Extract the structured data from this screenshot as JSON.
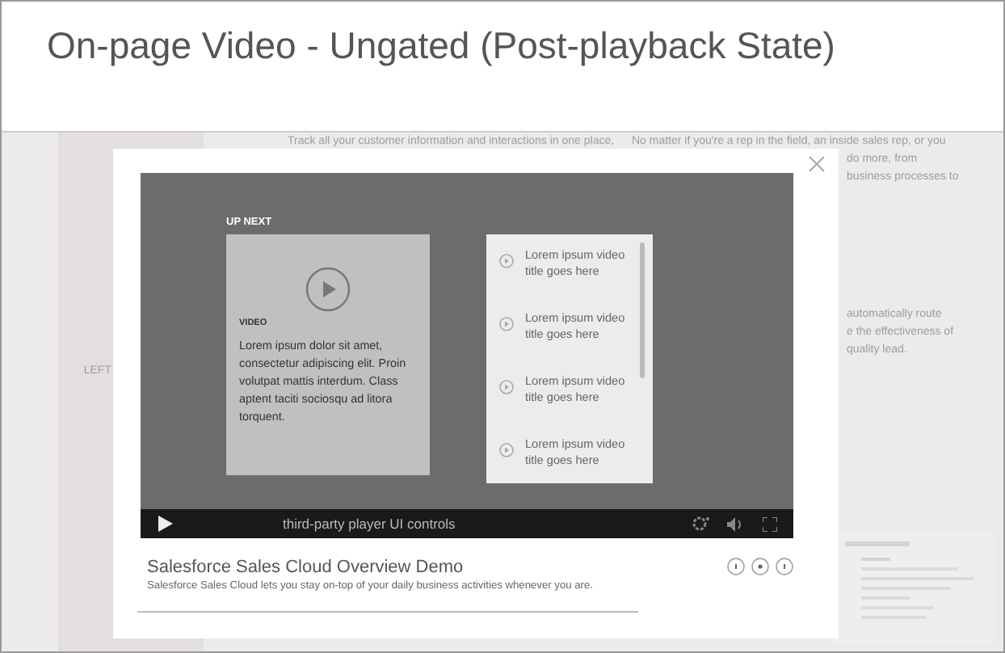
{
  "header": {
    "title": "On-page Video - Ungated (Post-playback State)"
  },
  "background": {
    "left_label": "LEFT",
    "column_1_text": "Track all your customer information and interactions in one place,",
    "column_2_text": "No matter if you're a rep in the field, an inside sales rep, or you",
    "right_lines_top": [
      "do more, from",
      "business processes to"
    ],
    "right_lines_middle": [
      "automatically route",
      "e the effectiveness of",
      "quality lead."
    ]
  },
  "modal": {
    "player": {
      "up_next_label": "UP NEXT",
      "featured": {
        "label": "VIDEO",
        "description": "Lorem ipsum dolor sit amet, consectetur adipiscing elit. Proin volutpat mattis interdum. Class aptent taciti sociosqu ad litora torquent."
      },
      "playlist": [
        {
          "title": "Lorem ipsum video title goes here"
        },
        {
          "title": "Lorem ipsum video title goes here"
        },
        {
          "title": "Lorem ipsum video title goes here"
        },
        {
          "title": "Lorem ipsum video title goes here"
        }
      ],
      "controls_label": "third-party player UI controls"
    },
    "title": "Salesforce Sales Cloud Overview Demo",
    "description": "Salesforce Sales Cloud lets you stay on-top of your daily business activities whenever you are."
  }
}
